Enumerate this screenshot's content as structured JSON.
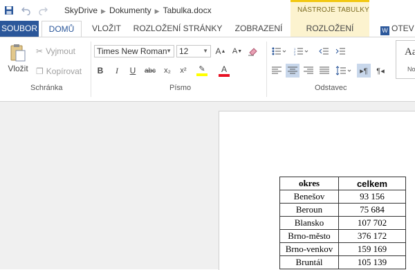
{
  "titlebar": {
    "breadcrumb": [
      "SkyDrive",
      "Dokumenty",
      "Tabulka.docx"
    ],
    "table_tools": "NÁSTROJE TABULKY"
  },
  "tabs": {
    "file": "SOUBOR",
    "home": "DOMŮ",
    "insert": "VLOŽIT",
    "page_layout": "ROZLOŽENÍ STRÁNKY",
    "view": "ZOBRAZENÍ",
    "table_layout": "ROZLOŽENÍ",
    "open_word": "OTEV"
  },
  "ribbon": {
    "clipboard": {
      "group_label": "Schránka",
      "paste": "Vložit",
      "cut": "Vyjmout",
      "copy": "Kopírovat"
    },
    "font": {
      "group_label": "Písmo",
      "font_name": "Times New Roman",
      "font_size": "12",
      "bold": "B",
      "italic": "I",
      "underline": "U",
      "strike": "abc",
      "subscript": "x₂",
      "superscript": "x²"
    },
    "paragraph": {
      "group_label": "Odstavec"
    },
    "styles": {
      "preview": "Aa",
      "name": "No"
    }
  },
  "table": {
    "headers": [
      "okres",
      "celkem"
    ],
    "rows": [
      [
        "Benešov",
        "93 156"
      ],
      [
        "Beroun",
        "75 684"
      ],
      [
        "Blansko",
        "107 702"
      ],
      [
        "Brno-město",
        "376 172"
      ],
      [
        "Brno-venkov",
        "159 169"
      ],
      [
        "Bruntál",
        "105 139"
      ]
    ]
  },
  "colors": {
    "accent": "#2b579a",
    "table_tools": "#f2c811",
    "highlight": "#ffff00",
    "font_color": "#e81123"
  }
}
